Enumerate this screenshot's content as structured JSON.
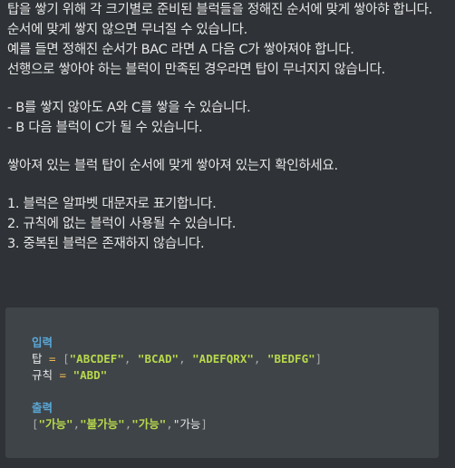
{
  "description": {
    "paragraph1": [
      "탑을 쌓기 위해 각 크기별로 준비된 블럭들을 정해진 순서에 맞게 쌓아햐 합니다.",
      "순서에 맞게 쌓지 않으면 무너질 수 있습니다.",
      "예를 들면 정해진 순서가 BAC 라면 A 다음 C가 쌓아져야 합니다.",
      "선행으로 쌓아야 하는 블럭이 만족된 경우라면 탑이 무너지지 않습니다."
    ],
    "bullets": [
      "- B를 쌓지 않아도 A와 C를 쌓을 수 있습니다.",
      "- B 다음 블럭이 C가 될 수 있습니다."
    ],
    "instruction": "쌓아져 있는 블럭 탑이 순서에 맞게 쌓아져 있는지 확인하세요.",
    "rules": [
      "1. 블럭은 알파벳 대문자로 표기합니다.",
      "2. 규칙에 없는 블럭이 사용될 수 있습니다.",
      "3. 중복된 블럭은 존재하지 않습니다."
    ]
  },
  "example": {
    "input_label": "입력",
    "tower_var": "탑",
    "tower_values": [
      "\"ABCDEF\"",
      "\"BCAD\"",
      "\"ADEFQRX\"",
      "\"BEDFG\""
    ],
    "rule_var": "규칙",
    "rule_value": "\"ABD\"",
    "output_label": "출력",
    "output_values": [
      "\"가능\"",
      "\"불가능\"",
      "\"가능\""
    ],
    "output_last": "\"가능"
  },
  "colors": {
    "background": "#2f3337",
    "code_box": "#3f4448",
    "label": "#5aa8d8",
    "string": "#b8d84c",
    "operator": "#f0b850"
  }
}
